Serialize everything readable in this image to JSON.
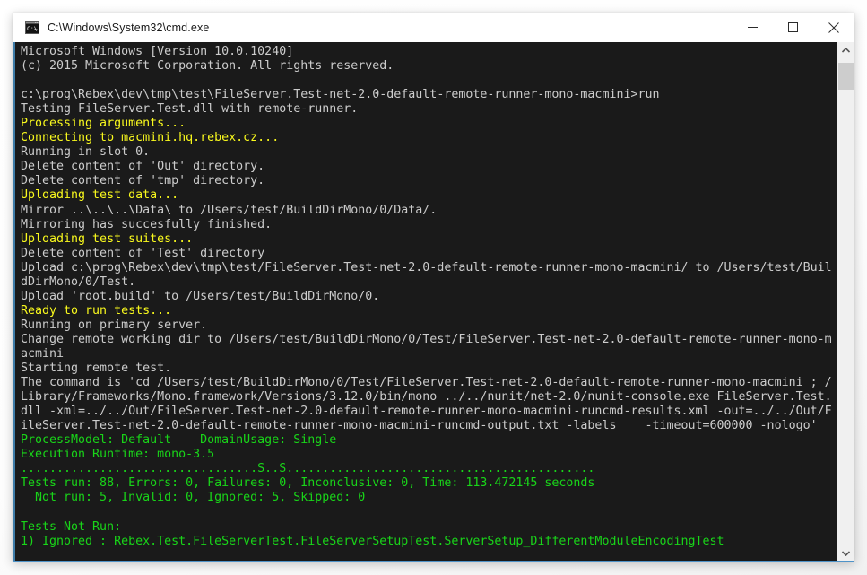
{
  "window": {
    "title": "C:\\Windows\\System32\\cmd.exe",
    "icon": "cmd-console-icon",
    "accent_border_color": "#4f93c8",
    "titlebar_bg": "#ffffff",
    "controls": {
      "minimize_label": "Minimize",
      "maximize_label": "Maximize",
      "close_label": "Close"
    }
  },
  "console": {
    "background_color": "#1a1a1a",
    "default_text_color": "#cccccc",
    "yellow_color": "#f9f91d",
    "green_color": "#19d519",
    "lines": [
      {
        "text": "Microsoft Windows [Version 10.0.10240]",
        "color": "white"
      },
      {
        "text": "(c) 2015 Microsoft Corporation. All rights reserved.",
        "color": "white"
      },
      {
        "text": "",
        "color": "white"
      },
      {
        "text": "c:\\prog\\Rebex\\dev\\tmp\\test\\FileServer.Test-net-2.0-default-remote-runner-mono-macmini>run",
        "color": "white"
      },
      {
        "text": "Testing FileServer.Test.dll with remote-runner.",
        "color": "white"
      },
      {
        "text": "Processing arguments...",
        "color": "yellow"
      },
      {
        "text": "Connecting to macmini.hq.rebex.cz...",
        "color": "yellow"
      },
      {
        "text": "Running in slot 0.",
        "color": "white"
      },
      {
        "text": "Delete content of 'Out' directory.",
        "color": "white"
      },
      {
        "text": "Delete content of 'tmp' directory.",
        "color": "white"
      },
      {
        "text": "Uploading test data...",
        "color": "yellow"
      },
      {
        "text": "Mirror ..\\..\\..\\Data\\ to /Users/test/BuildDirMono/0/Data/.",
        "color": "white"
      },
      {
        "text": "Mirroring has succesfully finished.",
        "color": "white"
      },
      {
        "text": "Uploading test suites...",
        "color": "yellow"
      },
      {
        "text": "Delete content of 'Test' directory",
        "color": "white"
      },
      {
        "text": "Upload c:\\prog\\Rebex\\dev\\tmp\\test/FileServer.Test-net-2.0-default-remote-runner-mono-macmini/ to /Users/test/Buil",
        "color": "white"
      },
      {
        "text": "dDirMono/0/Test.",
        "color": "white"
      },
      {
        "text": "Upload 'root.build' to /Users/test/BuildDirMono/0.",
        "color": "white"
      },
      {
        "text": "Ready to run tests...",
        "color": "yellow"
      },
      {
        "text": "Running on primary server.",
        "color": "white"
      },
      {
        "text": "Change remote working dir to /Users/test/BuildDirMono/0/Test/FileServer.Test-net-2.0-default-remote-runner-mono-m",
        "color": "white"
      },
      {
        "text": "acmini",
        "color": "white"
      },
      {
        "text": "Starting remote test.",
        "color": "white"
      },
      {
        "text": "The command is 'cd /Users/test/BuildDirMono/0/Test/FileServer.Test-net-2.0-default-remote-runner-mono-macmini ; /",
        "color": "white"
      },
      {
        "text": "Library/Frameworks/Mono.framework/Versions/3.12.0/bin/mono ../../nunit/net-2.0/nunit-console.exe FileServer.Test.",
        "color": "white"
      },
      {
        "text": "dll -xml=../../Out/FileServer.Test-net-2.0-default-remote-runner-mono-macmini-runcmd-results.xml -out=../../Out/F",
        "color": "white"
      },
      {
        "text": "ileServer.Test-net-2.0-default-remote-runner-mono-macmini-runcmd-output.txt -labels    -timeout=600000 -nologo'",
        "color": "white"
      },
      {
        "text": "ProcessModel: Default    DomainUsage: Single",
        "color": "green"
      },
      {
        "text": "Execution Runtime: mono-3.5",
        "color": "green"
      },
      {
        "text": ".................................S..S...........................................",
        "color": "green"
      },
      {
        "text": "Tests run: 88, Errors: 0, Failures: 0, Inconclusive: 0, Time: 113.472145 seconds",
        "color": "green"
      },
      {
        "text": "  Not run: 5, Invalid: 0, Ignored: 5, Skipped: 0",
        "color": "green"
      },
      {
        "text": "",
        "color": "green"
      },
      {
        "text": "Tests Not Run:",
        "color": "green"
      },
      {
        "text": "1) Ignored : Rebex.Test.FileServerTest.FileServerSetupTest.ServerSetup_DifferentModuleEncodingTest",
        "color": "green"
      }
    ]
  },
  "scrollbar": {
    "up_arrow_label": "Scroll up",
    "down_arrow_label": "Scroll down",
    "thumb_label": "Scroll thumb"
  }
}
